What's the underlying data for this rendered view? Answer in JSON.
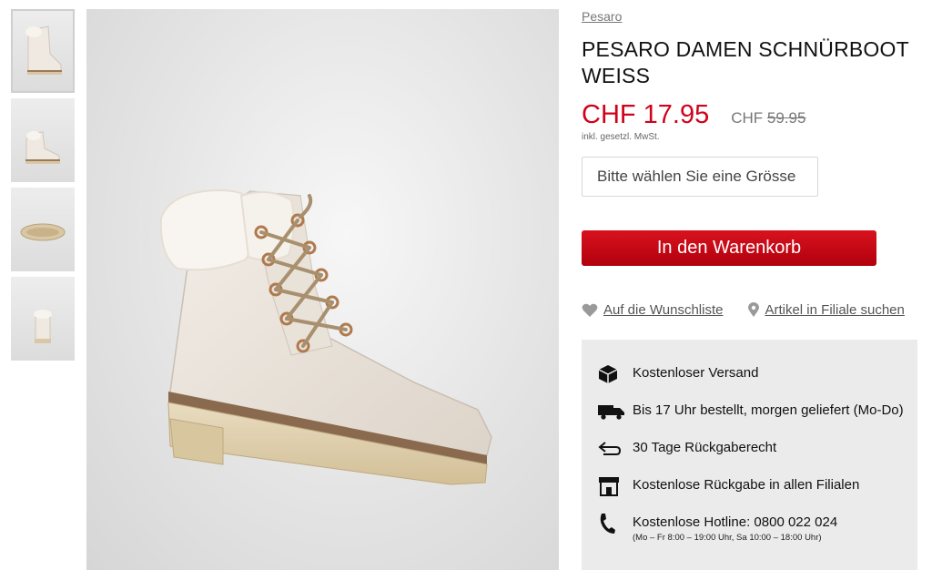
{
  "thumbnails": [
    {
      "label": "side view"
    },
    {
      "label": "outer side view"
    },
    {
      "label": "sole view"
    },
    {
      "label": "back view"
    }
  ],
  "product": {
    "brand": "Pesaro",
    "title": "PESARO DAMEN SCHNÜRBOOT WEISS",
    "price_now": "CHF 17.95",
    "price_old_currency": "CHF",
    "price_old_value": "59.95",
    "vat_note": "inkl. gesetzl. MwSt.",
    "size_placeholder": "Bitte wählen Sie eine Grösse",
    "cart_label": "In den Warenkorb"
  },
  "links": {
    "wishlist": "Auf die Wunschliste",
    "store_search": "Artikel in Filiale suchen"
  },
  "usps": [
    {
      "icon": "box-icon",
      "text": "Kostenloser Versand"
    },
    {
      "icon": "truck-icon",
      "text": "Bis 17 Uhr bestellt, morgen geliefert (Mo-Do)"
    },
    {
      "icon": "return-arrow-icon",
      "text": "30 Tage Rückgaberecht"
    },
    {
      "icon": "store-icon",
      "text": "Kostenlose Rückgabe in allen Filialen"
    },
    {
      "icon": "phone-icon",
      "text": "Kostenlose Hotline: 0800 022 024",
      "sub": "(Mo – Fr 8:00 – 19:00 Uhr, Sa 10:00 – 18:00 Uhr)"
    }
  ],
  "colors": {
    "accent_red": "#d0021b",
    "usp_background": "#ebebeb"
  }
}
